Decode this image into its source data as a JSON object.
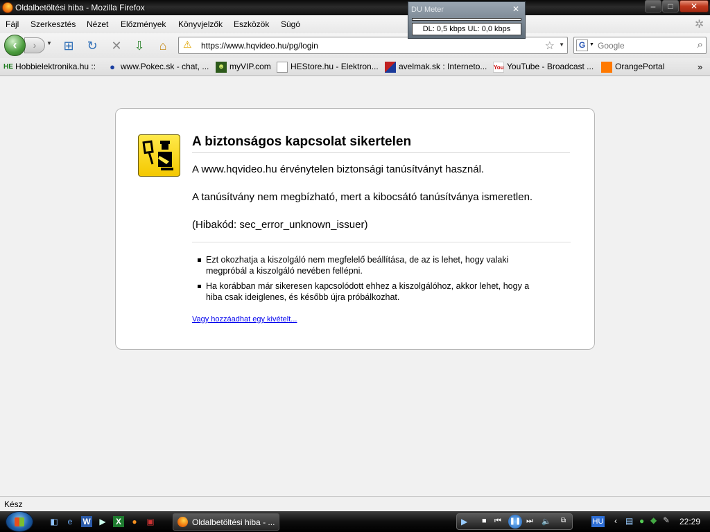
{
  "window": {
    "title": "Oldalbetöltési hiba - Mozilla Firefox",
    "controls": {
      "minimize": "–",
      "maximize": "□",
      "close": "✕"
    }
  },
  "menu": {
    "items": [
      "Fájl",
      "Szerkesztés",
      "Nézet",
      "Előzmények",
      "Könyvjelzők",
      "Eszközök",
      "Súgó"
    ]
  },
  "du_meter": {
    "title": "DU Meter",
    "close": "✕",
    "value": "DL: 0,5 kbps  UL: 0,0 kbps"
  },
  "toolbar": {
    "back": "‹",
    "forward": "›"
  },
  "address": {
    "url": "https://www.hqvideo.hu/pg/login"
  },
  "search": {
    "engine_letter": "G",
    "placeholder": "Google"
  },
  "bookmarks": {
    "items": [
      {
        "label": "Hobbielektronika.hu ::",
        "icon": "he-icon"
      },
      {
        "label": "www.Pokec.sk - chat, ...",
        "icon": "pokec-icon"
      },
      {
        "label": "myVIP.com",
        "icon": "myvip-icon"
      },
      {
        "label": "HEStore.hu - Elektron...",
        "icon": "page-icon"
      },
      {
        "label": "avelmak.sk : Interneto...",
        "icon": "avelmak-icon"
      },
      {
        "label": "YouTube - Broadcast ...",
        "icon": "youtube-icon"
      },
      {
        "label": "OrangePortal",
        "icon": "orange-icon"
      }
    ],
    "overflow": "»"
  },
  "error": {
    "title": "A biztonságos kapcsolat sikertelen",
    "p1": "A www.hqvideo.hu érvénytelen biztonsági tanúsítványt használ.",
    "p2": "A tanúsítvány nem megbízható, mert a kibocsátó tanúsítványa ismeretlen.",
    "p3": "(Hibakód: sec_error_unknown_issuer)",
    "bullets": [
      "Ezt okozhatja a kiszolgáló nem megfelelő beállítása, de az is lehet, hogy valaki megpróbál a kiszolgáló nevében fellépni.",
      "Ha korábban már sikeresen kapcsolódott ehhez a kiszolgálóhoz, akkor lehet, hogy a hiba csak ideiglenes, és később újra próbálkozhat."
    ],
    "exception_link": "Vagy hozzáadhat egy kivételt..."
  },
  "status": {
    "text": "Kész"
  },
  "taskbar": {
    "active_window": "Oldalbetöltési hiba - ...",
    "language": "HU",
    "clock": "22:29"
  }
}
